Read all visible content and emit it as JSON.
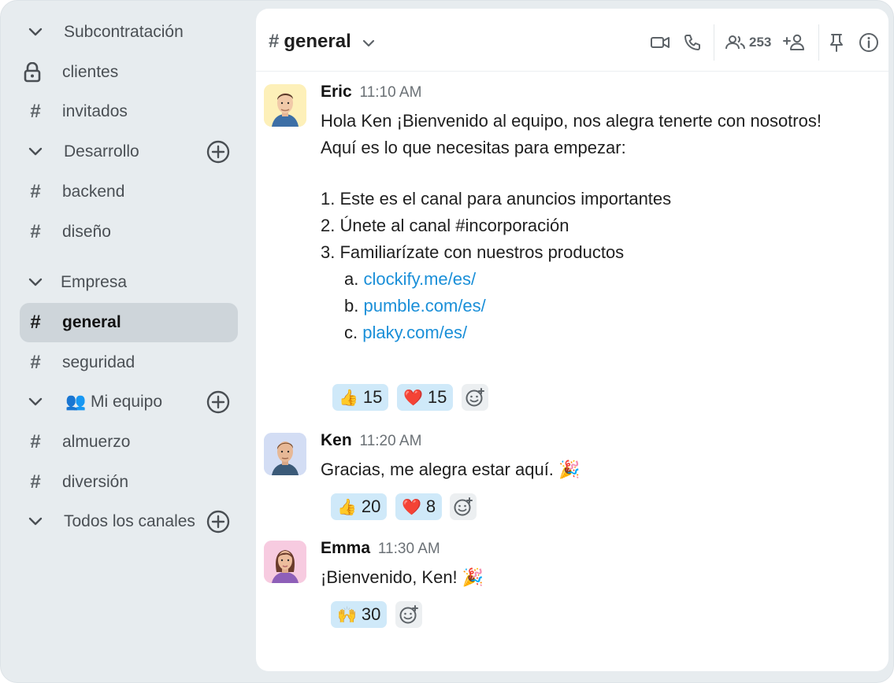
{
  "sidebar": {
    "sections": [
      {
        "label": "Subcontratación"
      },
      {
        "label": "Desarrollo"
      },
      {
        "label": "Empresa"
      },
      {
        "label": "👥 Mi equipo"
      },
      {
        "label": "Todos los canales"
      }
    ],
    "channels": {
      "clientes": "clientes",
      "invitados": "invitados",
      "backend": "backend",
      "diseno": "diseño",
      "general": "general",
      "seguridad": "seguridad",
      "almuerzo": "almuerzo",
      "diversion": "diversión"
    }
  },
  "header": {
    "channel_name": "general",
    "member_count": "253"
  },
  "messages": [
    {
      "author": "Eric",
      "time": "11:10 AM",
      "lines": [
        "Hola Ken ¡Bienvenido al equipo, nos alegra tenerte con nosotros!",
        "Aquí es lo que necesitas para empezar:",
        "1. Este es el canal para anuncios importantes",
        "2. Únete al canal #incorporación",
        "3. Familiarízate con nuestros productos"
      ],
      "sublist": [
        {
          "prefix": "a.",
          "link": "clockify.me/es/"
        },
        {
          "prefix": "b.",
          "link": "pumble.com/es/"
        },
        {
          "prefix": "c.",
          "link": "plaky.com/es/"
        }
      ],
      "reactions": [
        {
          "emoji": "👍",
          "count": "15"
        },
        {
          "emoji": "❤️",
          "count": "15"
        }
      ]
    },
    {
      "author": "Ken",
      "time": "11:20 AM",
      "text": "Gracias, me alegra estar aquí. 🎉",
      "reactions": [
        {
          "emoji": "👍",
          "count": "20"
        },
        {
          "emoji": "❤️",
          "count": "8"
        }
      ]
    },
    {
      "author": "Emma",
      "time": "11:30 AM",
      "text": "¡Bienvenido, Ken! 🎉",
      "reactions": [
        {
          "emoji": "🙌",
          "count": "30"
        }
      ]
    }
  ],
  "colors": {
    "accent_link": "#1a8fd8",
    "reaction_bg": "#cfe9f9",
    "sidebar_bg": "#e7ecef",
    "active_item_bg": "#ced5da"
  },
  "icons": [
    "chevron-down-icon",
    "lock-icon",
    "hash-icon",
    "plus-circle-icon",
    "video-icon",
    "phone-icon",
    "members-icon",
    "add-member-icon",
    "pin-icon",
    "info-icon",
    "add-reaction-icon"
  ]
}
